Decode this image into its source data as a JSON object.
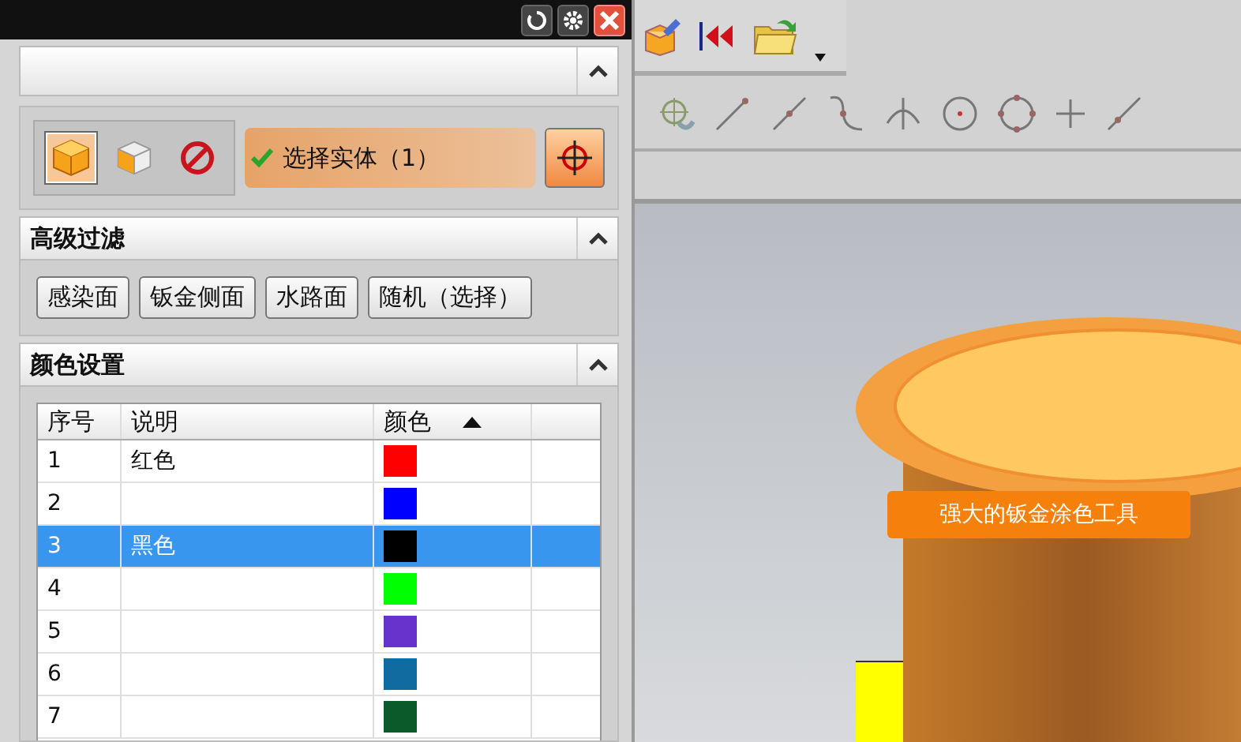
{
  "selection": {
    "filters": [
      {
        "kind": "solid",
        "selected": true
      },
      {
        "kind": "face",
        "selected": false
      },
      {
        "kind": "none",
        "selected": false
      }
    ],
    "label": "选择实体（1）",
    "checked": true
  },
  "filter_section": {
    "title": "高级过滤",
    "expanded": true,
    "buttons": [
      "感染面",
      "钣金侧面",
      "水路面",
      "随机（选择）"
    ]
  },
  "color_section": {
    "title": "颜色设置",
    "expanded": true,
    "table": {
      "columns": [
        "序号",
        "说明",
        "颜色"
      ],
      "sort_ascending": true,
      "rows": [
        {
          "index": "1",
          "description": "红色",
          "color": "#ff0000",
          "selected": false
        },
        {
          "index": "2",
          "description": "",
          "color": "#0000ff",
          "selected": false
        },
        {
          "index": "3",
          "description": "黑色",
          "color": "#000000",
          "selected": true
        },
        {
          "index": "4",
          "description": "",
          "color": "#00ff00",
          "selected": false
        },
        {
          "index": "5",
          "description": "",
          "color": "#6633cc",
          "selected": false
        },
        {
          "index": "6",
          "description": "",
          "color": "#106ba0",
          "selected": false
        },
        {
          "index": "7",
          "description": "",
          "color": "#0b5a2a",
          "selected": false
        }
      ]
    }
  },
  "viewport": {
    "caption": "强大的钣金涂色工具"
  }
}
